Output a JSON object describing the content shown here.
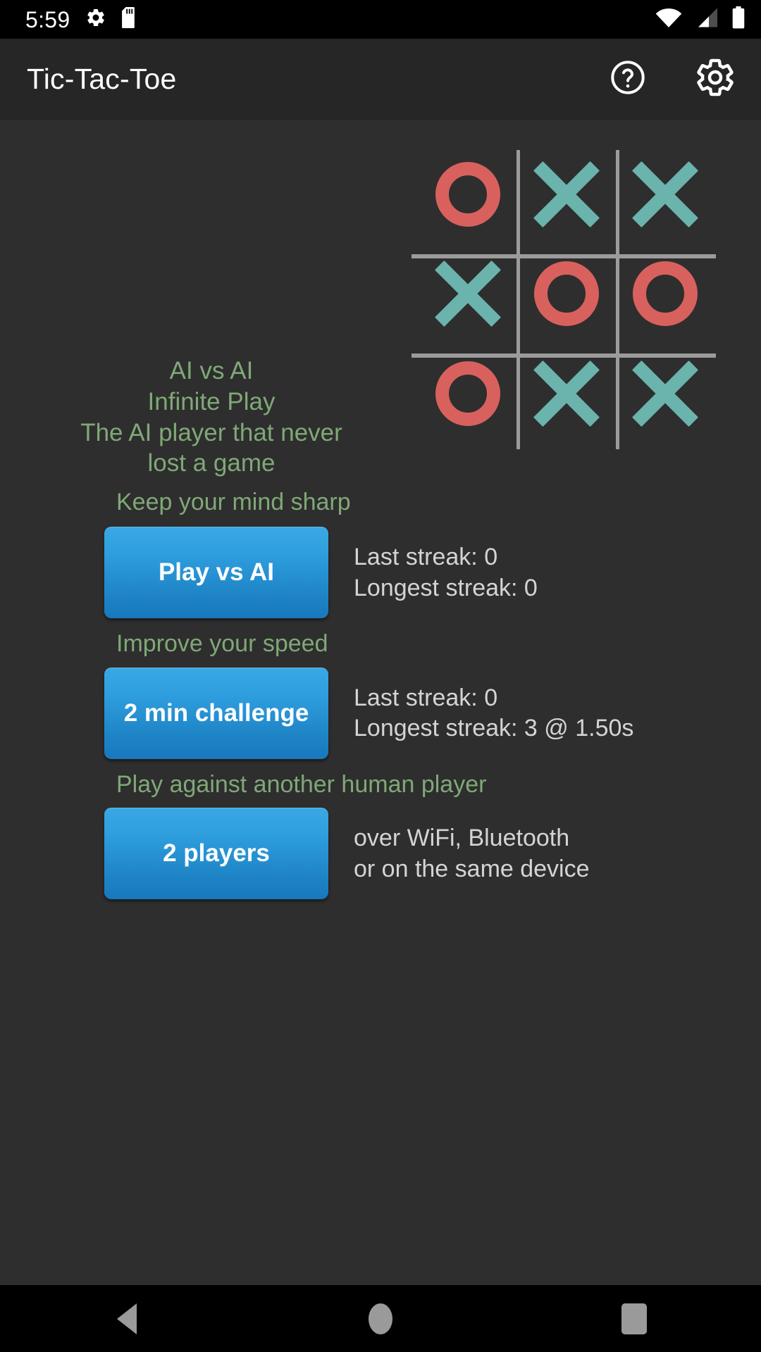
{
  "status_bar": {
    "clock": "5:59",
    "left_icons": [
      "gear-icon",
      "sd-card-icon"
    ],
    "right_icons": [
      "wifi-icon",
      "cell-signal-icon",
      "battery-icon"
    ]
  },
  "app_bar": {
    "title": "Tic-Tac-Toe",
    "actions": [
      {
        "name": "help-icon",
        "label": "?"
      },
      {
        "name": "settings-gear-icon",
        "label": "Settings"
      }
    ]
  },
  "hero": {
    "tagline": [
      "AI vs AI",
      "Infinite Play",
      "The AI player that never",
      "lost a game"
    ],
    "board": {
      "cells": [
        [
          "O",
          "X",
          "X"
        ],
        [
          "X",
          "O",
          "O"
        ],
        [
          "O",
          "X",
          "X"
        ]
      ]
    }
  },
  "modes": [
    {
      "heading": "Keep your mind sharp",
      "button_label": "Play vs AI",
      "stats": [
        "Last streak: 0",
        "Longest streak: 0"
      ]
    },
    {
      "heading": "Improve your speed",
      "button_label": "2 min challenge",
      "stats": [
        "Last streak: 0",
        "Longest streak: 3 @ 1.50s"
      ]
    },
    {
      "heading": "Play against another human player",
      "button_label": "2 players",
      "stats": [
        "over WiFi, Bluetooth",
        "or on the same device"
      ]
    }
  ],
  "nav_bar": {
    "back": "Back",
    "home": "Home",
    "recents": "Recent apps"
  },
  "colors": {
    "background": "#2e2e2e",
    "app_bar": "#262626",
    "accent_green": "#7fa877",
    "mark_o": "#d8615e",
    "mark_x": "#6bb3ad",
    "button_blue_top": "#3aa8e3",
    "button_blue_bottom": "#1878bd",
    "stats_text": "#d4d4d4",
    "grid_line": "#9b9b9b"
  }
}
